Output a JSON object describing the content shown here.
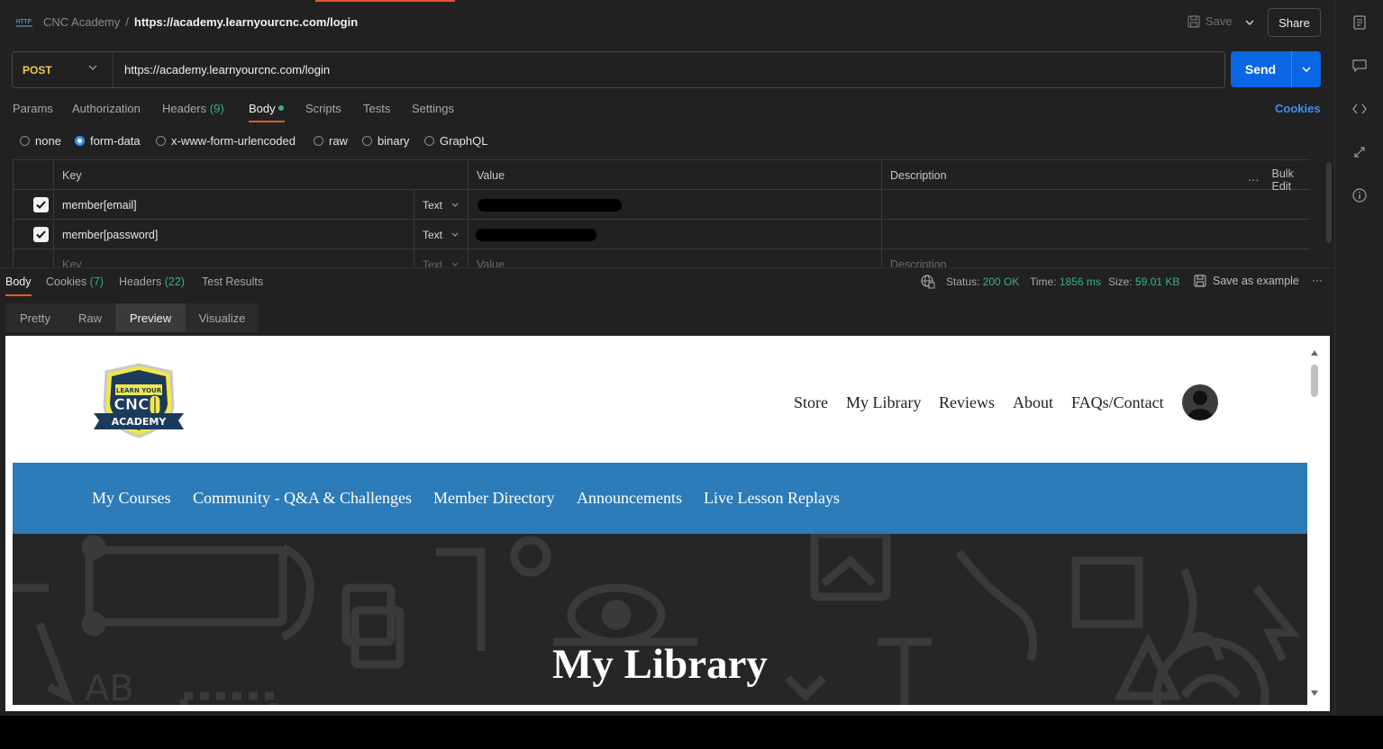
{
  "header": {
    "workspace": "CNC Academy",
    "separator": "/",
    "request_name": "https://academy.learnyourcnc.com/login",
    "save_label": "Save",
    "share_label": "Share"
  },
  "request": {
    "method": "POST",
    "url": "https://academy.learnyourcnc.com/login",
    "send_label": "Send"
  },
  "request_tabs": {
    "params": "Params",
    "authorization": "Authorization",
    "headers": "Headers",
    "headers_count": "(9)",
    "body": "Body",
    "scripts": "Scripts",
    "tests": "Tests",
    "settings": "Settings",
    "cookies": "Cookies"
  },
  "body_types": {
    "none": "none",
    "form_data": "form-data",
    "urlencoded": "x-www-form-urlencoded",
    "raw": "raw",
    "binary": "binary",
    "graphql": "GraphQL",
    "selected": "form-data"
  },
  "form_table": {
    "headers": {
      "key": "Key",
      "value": "Value",
      "description": "Description",
      "bulk_edit": "Bulk Edit"
    },
    "rows": [
      {
        "key": "member[email]",
        "type": "Text",
        "checked": true
      },
      {
        "key": "member[password]",
        "type": "Text",
        "checked": true
      }
    ],
    "new_row": {
      "key": "Key",
      "type": "Text",
      "value": "Value",
      "description": "Description"
    }
  },
  "response_tabs": {
    "body": "Body",
    "cookies": "Cookies",
    "cookies_count": "(7)",
    "headers": "Headers",
    "headers_count": "(22)",
    "test_results": "Test Results"
  },
  "response_meta": {
    "status_label": "Status:",
    "status_value": "200 OK",
    "time_label": "Time:",
    "time_value": "1856 ms",
    "size_label": "Size:",
    "size_value": "59.01 KB",
    "save_example": "Save as example"
  },
  "view_tabs": {
    "pretty": "Pretty",
    "raw": "Raw",
    "preview": "Preview",
    "visualize": "Visualize",
    "selected": "Preview"
  },
  "preview_site": {
    "logo_text_top": "LEARN YOUR",
    "logo_text_mid": "CNC",
    "logo_text_bottom": "ACADEMY",
    "top_nav": [
      "Store",
      "My Library",
      "Reviews",
      "About",
      "FAQs/Contact"
    ],
    "main_nav": [
      "My Courses",
      "Community - Q&A & Challenges",
      "Member Directory",
      "Announcements",
      "Live Lesson Replays"
    ],
    "hero_title": "My Library",
    "hero_bg_text": "AB"
  },
  "colors": {
    "accent_orange": "#e2582f",
    "send_blue": "#0b66e4",
    "success_green": "#36b37e",
    "method_yellow": "#f3c94b",
    "site_blue": "#2b7cb8"
  }
}
